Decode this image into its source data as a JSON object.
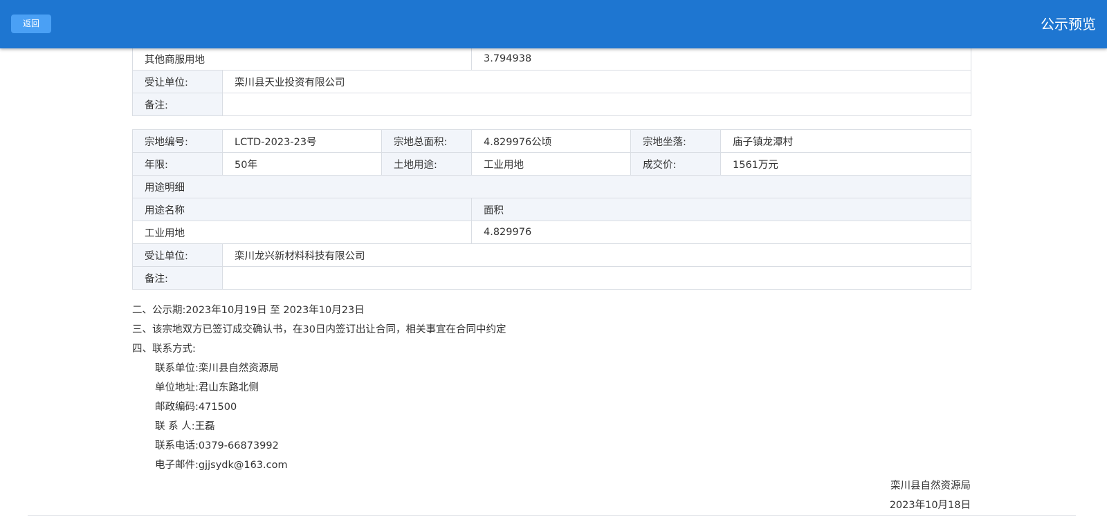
{
  "header": {
    "back_label": "返回",
    "title": "公示预览"
  },
  "parcel_prev": {
    "usage_row": {
      "name": "其他商服用地",
      "area": "3.794938"
    },
    "assignee_label": "受让单位:",
    "assignee": "栾川县天业投资有限公司",
    "remark_label": "备注:",
    "remark": ""
  },
  "parcel": {
    "code_label": "宗地编号:",
    "code": "LCTD-2023-23号",
    "total_area_label": "宗地总面积:",
    "total_area": "4.829976公顷",
    "location_label": "宗地坐落:",
    "location": "庙子镇龙潭村",
    "term_label": "年限:",
    "term": "50年",
    "land_use_label": "土地用途:",
    "land_use": "工业用地",
    "price_label": "成交价:",
    "price": "1561万元",
    "usage_detail_title": "用途明细",
    "usage_name_header": "用途名称",
    "usage_area_header": "面积",
    "usage_rows": [
      {
        "name": "工业用地",
        "area": "4.829976"
      }
    ],
    "assignee_label": "受让单位:",
    "assignee": "栾川龙兴新材料科技有限公司",
    "remark_label": "备注:",
    "remark": ""
  },
  "notes": {
    "period": "二、公示期:2023年10月19日 至 2023年10月23日",
    "contract": "三、该宗地双方已签订成交确认书，在30日内签订出让合同，相关事宜在合同中约定",
    "contact_title": "四、联系方式:",
    "contact_lines": [
      "联系单位:栾川县自然资源局",
      "单位地址:君山东路北侧",
      "邮政编码:471500",
      "联 系 人:王磊",
      "联系电话:0379-66873992",
      "电子邮件:gjjsydk@163.com"
    ]
  },
  "signature": {
    "org": "栾川县自然资源局",
    "date": "2023年10月18日"
  }
}
